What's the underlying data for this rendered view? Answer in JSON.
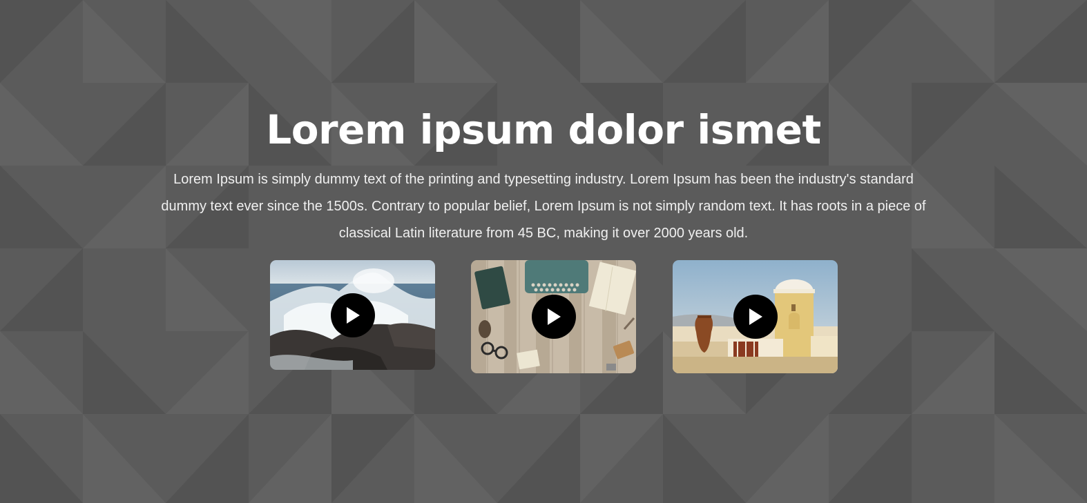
{
  "hero": {
    "title": "Lorem ipsum dolor ismet",
    "description": "Lorem Ipsum is simply dummy text of the printing and typesetting industry. Lorem Ipsum has been the industry's standard dummy text ever since the 1500s. Contrary to popular belief, Lorem Ipsum is not simply random text. It has roots in a piece of classical Latin literature from 45 BC, making it over 2000 years old."
  },
  "videos": [
    {
      "thumbnail": "ocean-waves-on-rocks",
      "icon": "play-icon"
    },
    {
      "thumbnail": "typewriter-desk-flatlay",
      "icon": "play-icon"
    },
    {
      "thumbnail": "santorini-tower-terrace",
      "icon": "play-icon"
    }
  ],
  "colors": {
    "background": "#5b5b5b",
    "title": "#ffffff",
    "text": "#f0f0f0",
    "play_button": "#000000"
  }
}
